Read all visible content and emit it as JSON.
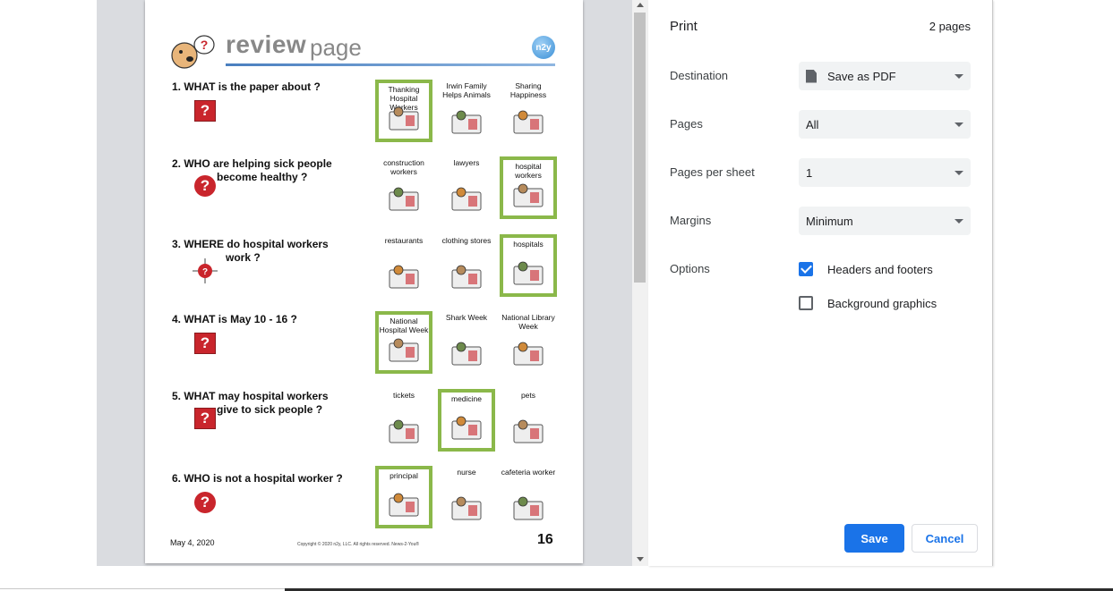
{
  "settings": {
    "title": "Print",
    "page_count": "2 pages",
    "destination_label": "Destination",
    "destination_value": "Save as PDF",
    "pages_label": "Pages",
    "pages_value": "All",
    "pages_per_sheet_label": "Pages per sheet",
    "pages_per_sheet_value": "1",
    "margins_label": "Margins",
    "margins_value": "Minimum",
    "options_label": "Options",
    "option_headers": "Headers and footers",
    "option_headers_checked": true,
    "option_background": "Background graphics",
    "option_background_checked": false,
    "save_label": "Save",
    "cancel_label": "Cancel",
    "accent_color": "#1a73e8"
  },
  "document": {
    "title_bold": "review",
    "title_light": "page",
    "logo_text": "n2y",
    "questions": [
      {
        "number": "1.",
        "line1": "WHAT  is the paper about ?",
        "line2": "",
        "icon": "question-box-icon",
        "choices": [
          {
            "label": "Thanking Hospital Workers",
            "selected": true
          },
          {
            "label": "Irwin Family Helps Animals",
            "selected": false
          },
          {
            "label": "Sharing Happiness",
            "selected": false
          }
        ]
      },
      {
        "number": "2.",
        "line1": "WHO  are helping sick people",
        "line2": "become healthy ?",
        "icon": "question-circle-icon",
        "choices": [
          {
            "label": "construction workers",
            "selected": false
          },
          {
            "label": "lawyers",
            "selected": false
          },
          {
            "label": "hospital workers",
            "selected": true
          }
        ]
      },
      {
        "number": "3.",
        "line1": "WHERE  do hospital workers",
        "line2": "work ?",
        "icon": "compass-question-icon",
        "choices": [
          {
            "label": "restaurants",
            "selected": false
          },
          {
            "label": "clothing stores",
            "selected": false
          },
          {
            "label": "hospitals",
            "selected": true
          }
        ]
      },
      {
        "number": "4.",
        "line1": "WHAT  is May 10 - 16 ?",
        "line2": "",
        "icon": "question-box-icon",
        "choices": [
          {
            "label": "National Hospital Week",
            "selected": true
          },
          {
            "label": "Shark Week",
            "selected": false
          },
          {
            "label": "National Library Week",
            "selected": false
          }
        ]
      },
      {
        "number": "5.",
        "line1": "WHAT  may hospital workers",
        "line2": "give to sick people ?",
        "icon": "question-box-icon",
        "choices": [
          {
            "label": "tickets",
            "selected": false
          },
          {
            "label": "medicine",
            "selected": true
          },
          {
            "label": "pets",
            "selected": false
          }
        ]
      },
      {
        "number": "6.",
        "line1": "WHO  is not a hospital worker ?",
        "line2": "",
        "icon": "question-circle-icon",
        "choices": [
          {
            "label": "principal",
            "selected": true
          },
          {
            "label": "nurse",
            "selected": false
          },
          {
            "label": "cafeteria worker",
            "selected": false
          }
        ]
      }
    ],
    "date": "May 4, 2020",
    "copyright": "Copyright © 2020 n2y, LLC. All rights reserved. News-2-You®",
    "page_number": "16",
    "selected_color": "#8bb84a"
  }
}
